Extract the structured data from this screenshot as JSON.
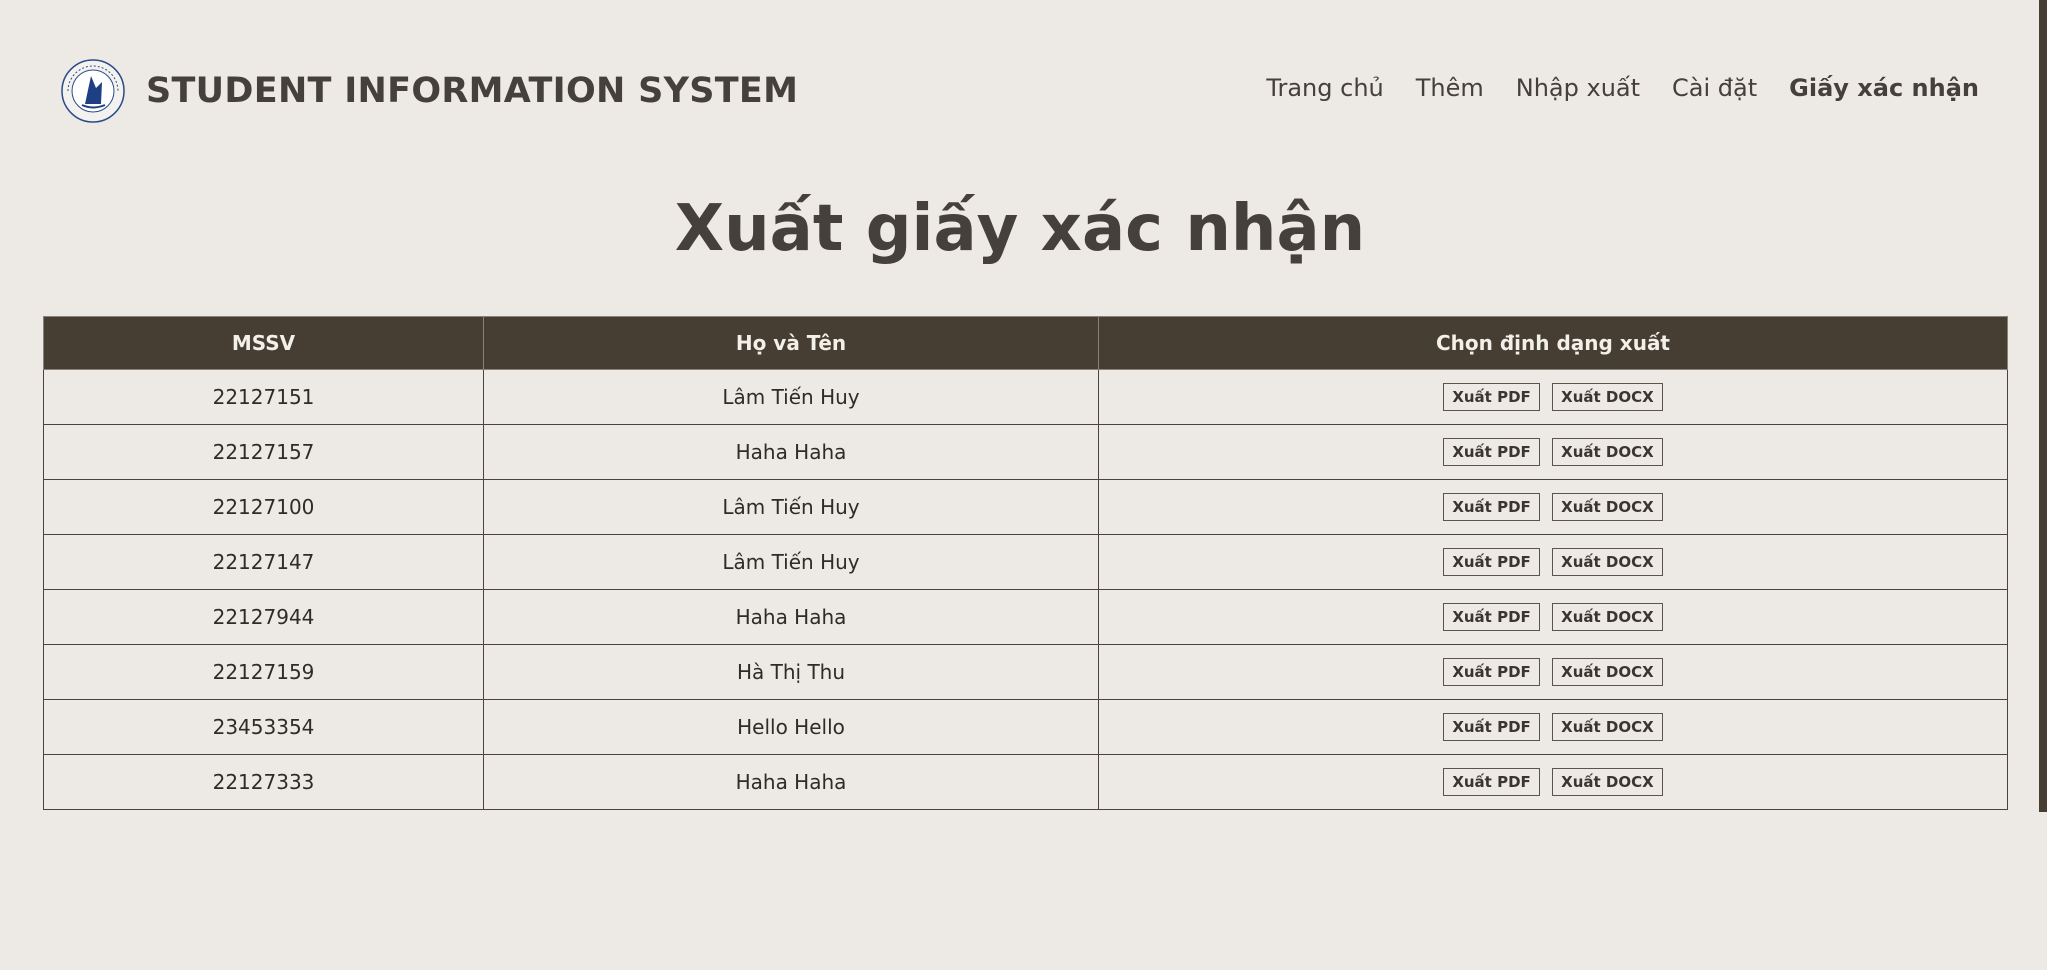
{
  "header": {
    "brand_title": "STUDENT INFORMATION SYSTEM",
    "logo_icon": "university-seal-icon",
    "nav": [
      {
        "label": "Trang chủ"
      },
      {
        "label": "Thêm"
      },
      {
        "label": "Nhập xuất"
      },
      {
        "label": "Cài đặt"
      },
      {
        "label": "Giấy xác nhận",
        "active": true
      }
    ]
  },
  "main": {
    "title": "Xuất giấy xác nhận",
    "table": {
      "headers": [
        "MSSV",
        "Họ và Tên",
        "Chọn định dạng xuất"
      ],
      "pdf_label": "Xuất PDF",
      "docx_label": "Xuất DOCX",
      "rows": [
        {
          "mssv": "22127151",
          "name": "Lâm Tiến Huy"
        },
        {
          "mssv": "22127157",
          "name": "Haha Haha"
        },
        {
          "mssv": "22127100",
          "name": "Lâm Tiến Huy"
        },
        {
          "mssv": "22127147",
          "name": "Lâm Tiến Huy"
        },
        {
          "mssv": "22127944",
          "name": "Haha Haha"
        },
        {
          "mssv": "22127159",
          "name": "Hà Thị Thu"
        },
        {
          "mssv": "23453354",
          "name": "Hello Hello"
        },
        {
          "mssv": "22127333",
          "name": "Haha Haha"
        }
      ]
    }
  },
  "colors": {
    "background": "#ede9e4",
    "header_dark": "#463e33",
    "text": "#45403a"
  }
}
